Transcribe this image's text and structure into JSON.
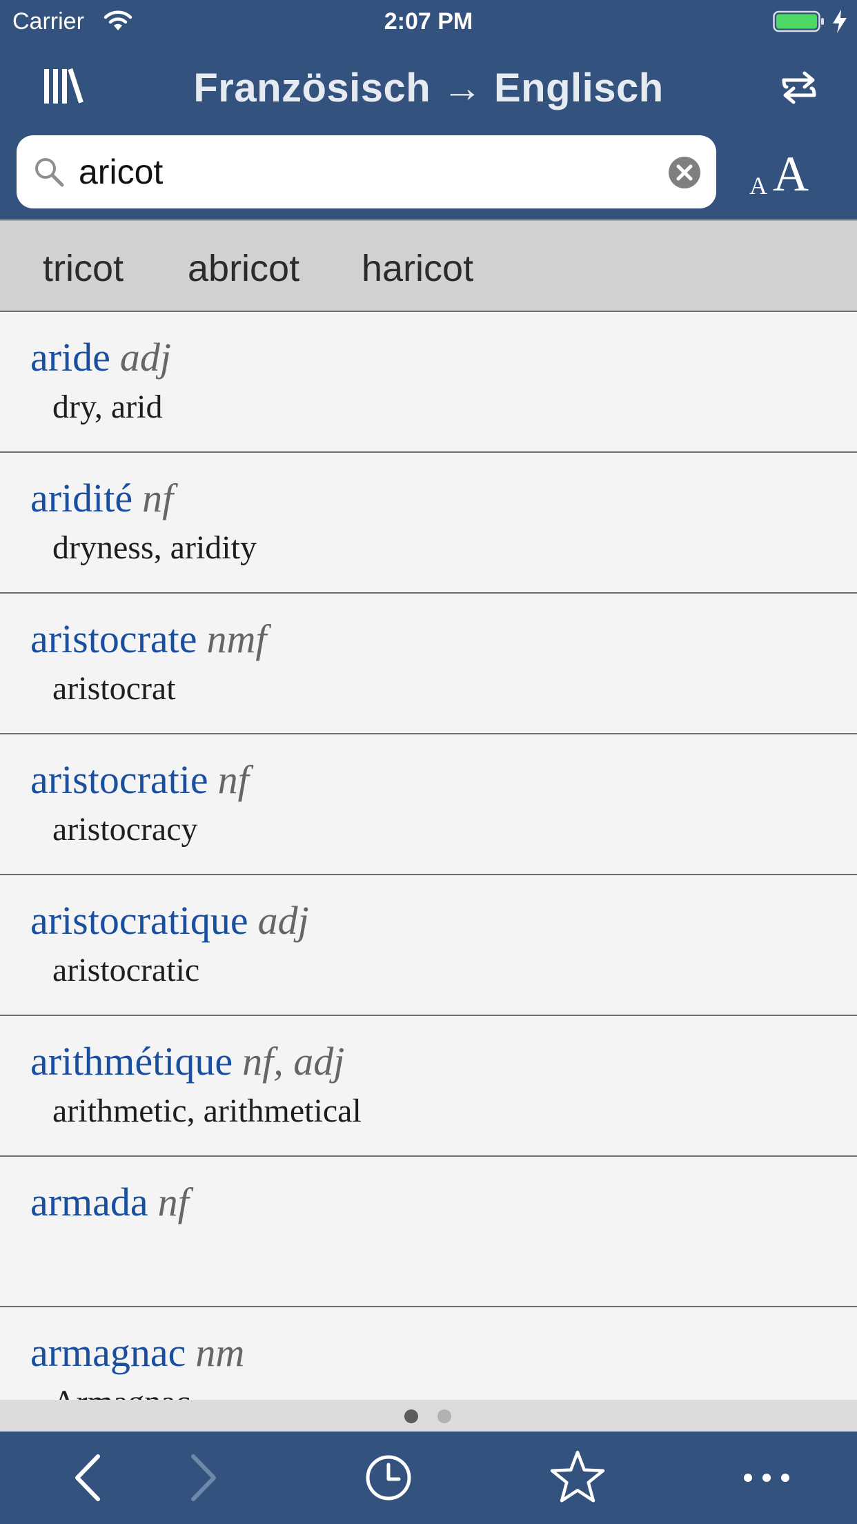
{
  "status_bar": {
    "carrier": "Carrier",
    "time": "2:07 PM",
    "battery_color": "#4cd964"
  },
  "header": {
    "title": "Französisch → Englisch",
    "background": "#33527d"
  },
  "search": {
    "value": "aricot",
    "placeholder": ""
  },
  "font_size": {
    "small": "A",
    "large": "A"
  },
  "suggestions": [
    "tricot",
    "abricot",
    "haricot"
  ],
  "entries": [
    {
      "term": "aride",
      "pos": "adj",
      "translation": "dry, arid"
    },
    {
      "term": "aridité",
      "pos": "nf",
      "translation": "dryness, aridity"
    },
    {
      "term": "aristocrate",
      "pos": "nmf",
      "translation": "aristocrat"
    },
    {
      "term": "aristocratie",
      "pos": "nf",
      "translation": "aristocracy"
    },
    {
      "term": "aristocratique",
      "pos": "adj",
      "translation": "aristocratic"
    },
    {
      "term": "arithmétique",
      "pos": "nf, adj",
      "translation": "arithmetic, arithmetical"
    },
    {
      "term": "armada",
      "pos": "nf",
      "translation": ""
    },
    {
      "term": "armagnac",
      "pos": "nm",
      "translation": "Armagnac"
    }
  ],
  "pager": {
    "pages": 2,
    "current": 1
  },
  "tab_bar": {
    "icons": [
      "back-icon",
      "forward-icon",
      "history-icon",
      "favorites-star-icon",
      "more-icon"
    ]
  },
  "colors": {
    "accent_term": "#1a4fa0",
    "pos": "#666666",
    "bar": "#33527d"
  }
}
